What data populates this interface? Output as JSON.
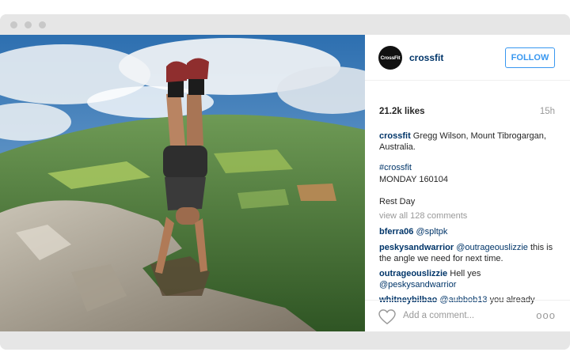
{
  "post": {
    "username": "crossfit",
    "avatar_text": "CrossFit",
    "follow_label": "FOLLOW",
    "likes": "21.2k likes",
    "time": "15h",
    "caption_line1": " Gregg Wilson, Mount Tibrogargan,",
    "caption_line2": "Australia.",
    "hashtag": "#crossfit",
    "date_line": "MONDAY 160104",
    "rest_day": "Rest Day",
    "view_all": "view all 128 comments"
  },
  "comments": [
    {
      "user": "bferra06",
      "mention": "@spltpk",
      "text": ""
    },
    {
      "user": "peskysandwarrior",
      "mention": "@outrageouslizzie",
      "text": " this is the angle we need for next time."
    },
    {
      "user": "outrageouslizzie",
      "mention": "@peskysandwarrior",
      "text": " Hell yes"
    },
    {
      "user": "whitneybilbao",
      "mention": "@aubbob13",
      "text": " you already"
    }
  ],
  "footer": {
    "add_comment_placeholder": "Add a comment...",
    "more_glyph": "ooo"
  },
  "icons": [
    "heart-icon",
    "more-options-icon"
  ],
  "colors": {
    "accent": "#3897f0",
    "username": "#003569",
    "muted": "#999999"
  }
}
